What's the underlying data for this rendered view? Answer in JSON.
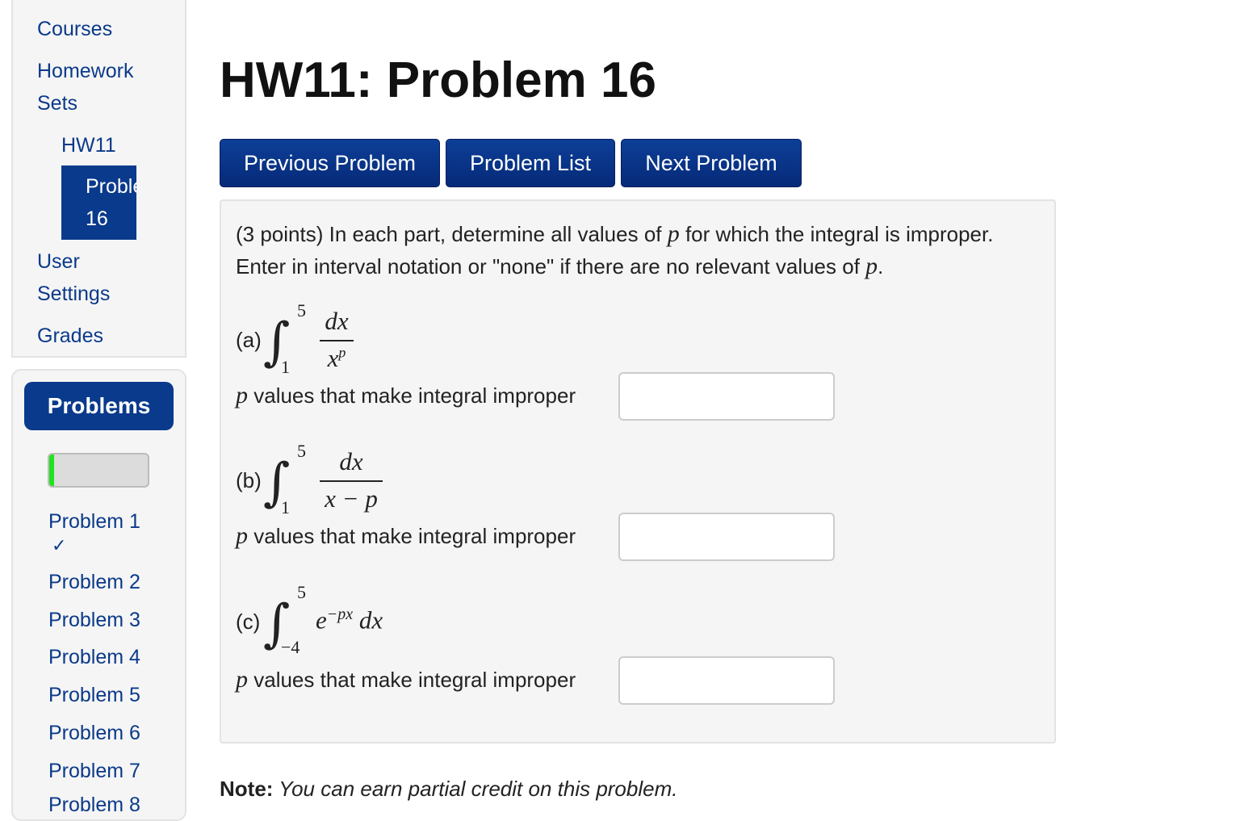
{
  "sidebar": {
    "nav": {
      "courses": "Courses",
      "homework_sets_line1": "Homework",
      "homework_sets_line2": "Sets",
      "hw11": "HW11",
      "active_line1": "Problem",
      "active_line2": "16",
      "user_settings_line1": "User",
      "user_settings_line2": "Settings",
      "grades": "Grades"
    },
    "problems_header": "Problems",
    "progress_fraction": 0.05,
    "progress_color": "#1ee31e",
    "problem_items": [
      {
        "label": "Problem 1",
        "status": "✓"
      },
      {
        "label": "Problem 2"
      },
      {
        "label": "Problem 3"
      },
      {
        "label": "Problem 4"
      },
      {
        "label": "Problem 5"
      },
      {
        "label": "Problem 6"
      },
      {
        "label": "Problem 7"
      },
      {
        "label": "Problem 8"
      }
    ]
  },
  "main": {
    "title": "HW11: Problem 16",
    "buttons": {
      "previous": "Previous Problem",
      "list": "Problem List",
      "next": "Next Problem"
    },
    "intro": {
      "part1": "(3 points) In each part, determine all values of ",
      "var": "p",
      "part2": " for which the integral is improper. Enter in interval notation or \"none\" if there are no relevant values of ",
      "part3": "."
    },
    "parts": [
      {
        "label": "(a)",
        "lower": "1",
        "upper": "5",
        "numerator": "dx",
        "denominator": "x",
        "denominator_exp": "p",
        "answer_label": "values that make integral improper",
        "answer_value": ""
      },
      {
        "label": "(b)",
        "lower": "1",
        "upper": "5",
        "numerator": "dx",
        "denominator": "x − p",
        "answer_label": "values that make integral improper",
        "answer_value": ""
      },
      {
        "label": "(c)",
        "lower": "−4",
        "upper": "5",
        "integrand_base": "e",
        "integrand_exp": "−px",
        "integrand_tail": "dx",
        "answer_label": "values that make integral improper",
        "answer_value": ""
      }
    ],
    "note_bold": "Note:",
    "note_text": " You can earn partial credit on this problem."
  },
  "colors": {
    "brand": "#0a3a8c",
    "link": "#0b3a8a",
    "panel": "#f5f5f5"
  }
}
